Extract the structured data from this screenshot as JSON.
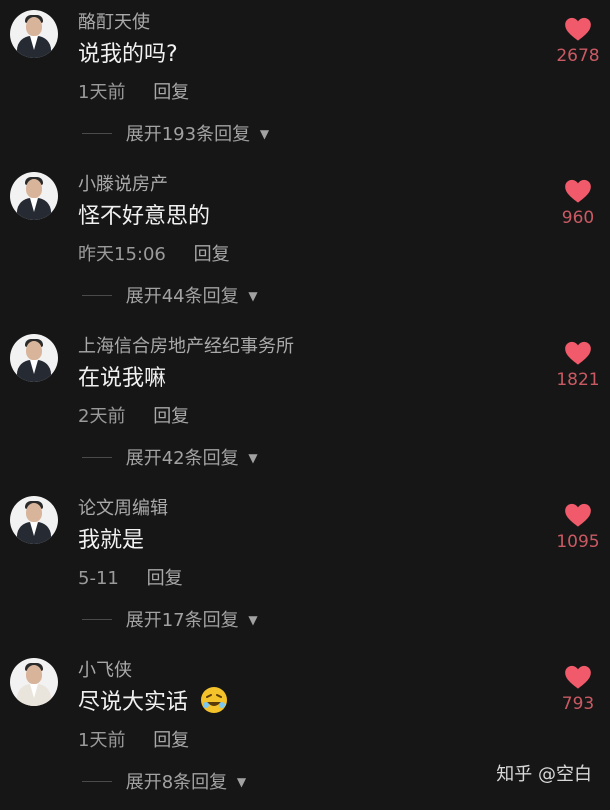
{
  "comments": [
    {
      "username": "酪酊天使",
      "text": "说我的吗?",
      "time": "1天前",
      "reply_label": "回复",
      "expand_label": "展开193条回复",
      "likes": "2678"
    },
    {
      "username": "小滕说房产",
      "text": "怪不好意思的",
      "time": "昨天15:06",
      "reply_label": "回复",
      "expand_label": "展开44条回复",
      "likes": "960"
    },
    {
      "username": "上海信合房地产经纪事务所",
      "text": "在说我嘛",
      "time": "2天前",
      "reply_label": "回复",
      "expand_label": "展开42条回复",
      "likes": "1821"
    },
    {
      "username": "论文周编辑",
      "text": "我就是",
      "time": "5-11",
      "reply_label": "回复",
      "expand_label": "展开17条回复",
      "likes": "1095"
    },
    {
      "username": "小飞侠",
      "text": "尽说大实话",
      "time": "1天前",
      "reply_label": "回复",
      "expand_label": "展开8条回复",
      "likes": "793"
    }
  ],
  "watermark": "知乎 @空白",
  "colors": {
    "background": "#161616",
    "heart": "#f05a6a",
    "like_count": "#c95a63"
  },
  "icons": [
    "avatar",
    "heart-icon",
    "caret-down-icon",
    "laughing-emoji-icon"
  ]
}
